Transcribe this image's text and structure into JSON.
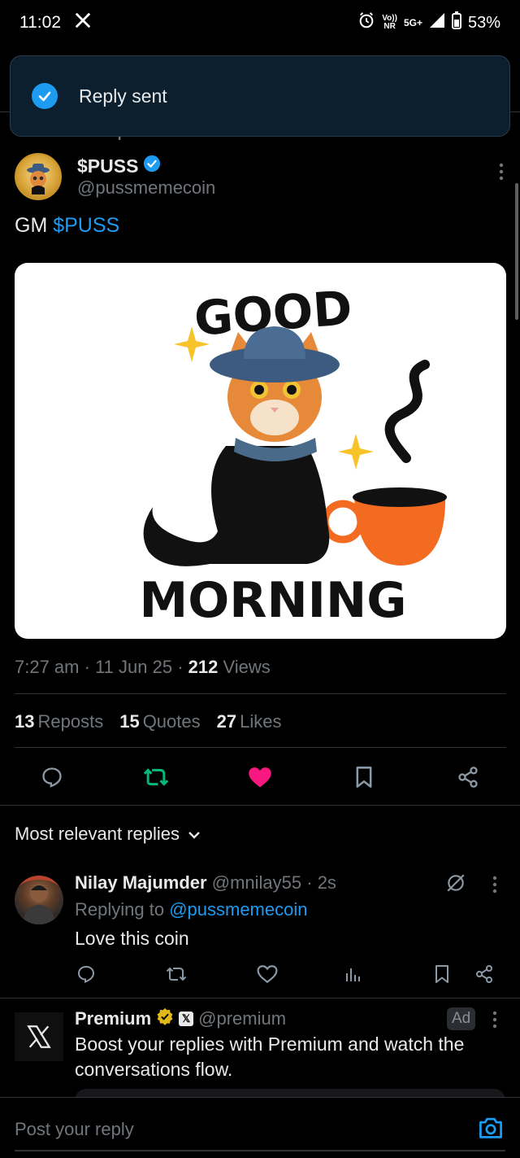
{
  "status_bar": {
    "time": "11:02",
    "network_top": "Vo))",
    "network_bottom": "NR",
    "signal": "5G+",
    "battery": "53%"
  },
  "toast": {
    "message": "Reply sent"
  },
  "repost_label": "You reposted",
  "post": {
    "author_name": "$PUSS",
    "author_handle": "@pussmemecoin",
    "text_plain": "GM ",
    "text_tag": "$PUSS",
    "image_caption_top": "GOOD",
    "image_caption_bottom": "MORNING",
    "time": "7:27 am",
    "date": "11 Jun 25",
    "views_count": "212",
    "views_label": "Views",
    "stats": {
      "reposts_count": "13",
      "reposts_label": "Reposts",
      "quotes_count": "15",
      "quotes_label": "Quotes",
      "likes_count": "27",
      "likes_label": "Likes"
    }
  },
  "actions": [
    "reply-icon",
    "repost-icon",
    "like-icon",
    "bookmark-icon",
    "share-icon"
  ],
  "colors": {
    "accent": "#1d9bf0",
    "repost": "#00ba7c",
    "like": "#f91880"
  },
  "replies_filter": "Most relevant replies",
  "reply": {
    "name": "Nilay Majumder",
    "handle": "@mnilay55",
    "time": "2s",
    "replying_prefix": "Replying to ",
    "replying_handle": "@pussmemecoin",
    "text": "Love this coin"
  },
  "ad": {
    "name": "Premium",
    "handle": "@premium",
    "ad_label": "Ad",
    "text": "Boost your replies with Premium and watch the conversations flow."
  },
  "compose": {
    "placeholder": "Post your reply"
  }
}
